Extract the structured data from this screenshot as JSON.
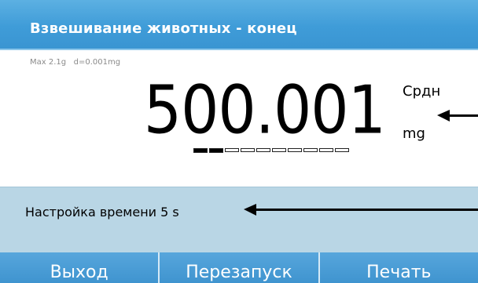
{
  "header": {
    "title": "Взвешивание животных - конец"
  },
  "balance": {
    "capacity": "Max 2.1g   d=0.001mg",
    "value": "500.001",
    "mode": "Срдн",
    "unit": "mg",
    "stability": {
      "filled_segments": 2,
      "total_segments": 10
    }
  },
  "status": {
    "text": "Настройка времени 5 s"
  },
  "softkeys": [
    {
      "label": "Выход"
    },
    {
      "label": "Перезапуск"
    },
    {
      "label": "Печать"
    }
  ],
  "colors": {
    "title_bar": "#3f9cd8",
    "status_area": "#b9d6e5",
    "softkey_bar": "#3f94cf"
  },
  "icons": {
    "annotation_arrow_value": "left-arrow-icon",
    "annotation_arrow_status": "left-arrow-icon"
  }
}
